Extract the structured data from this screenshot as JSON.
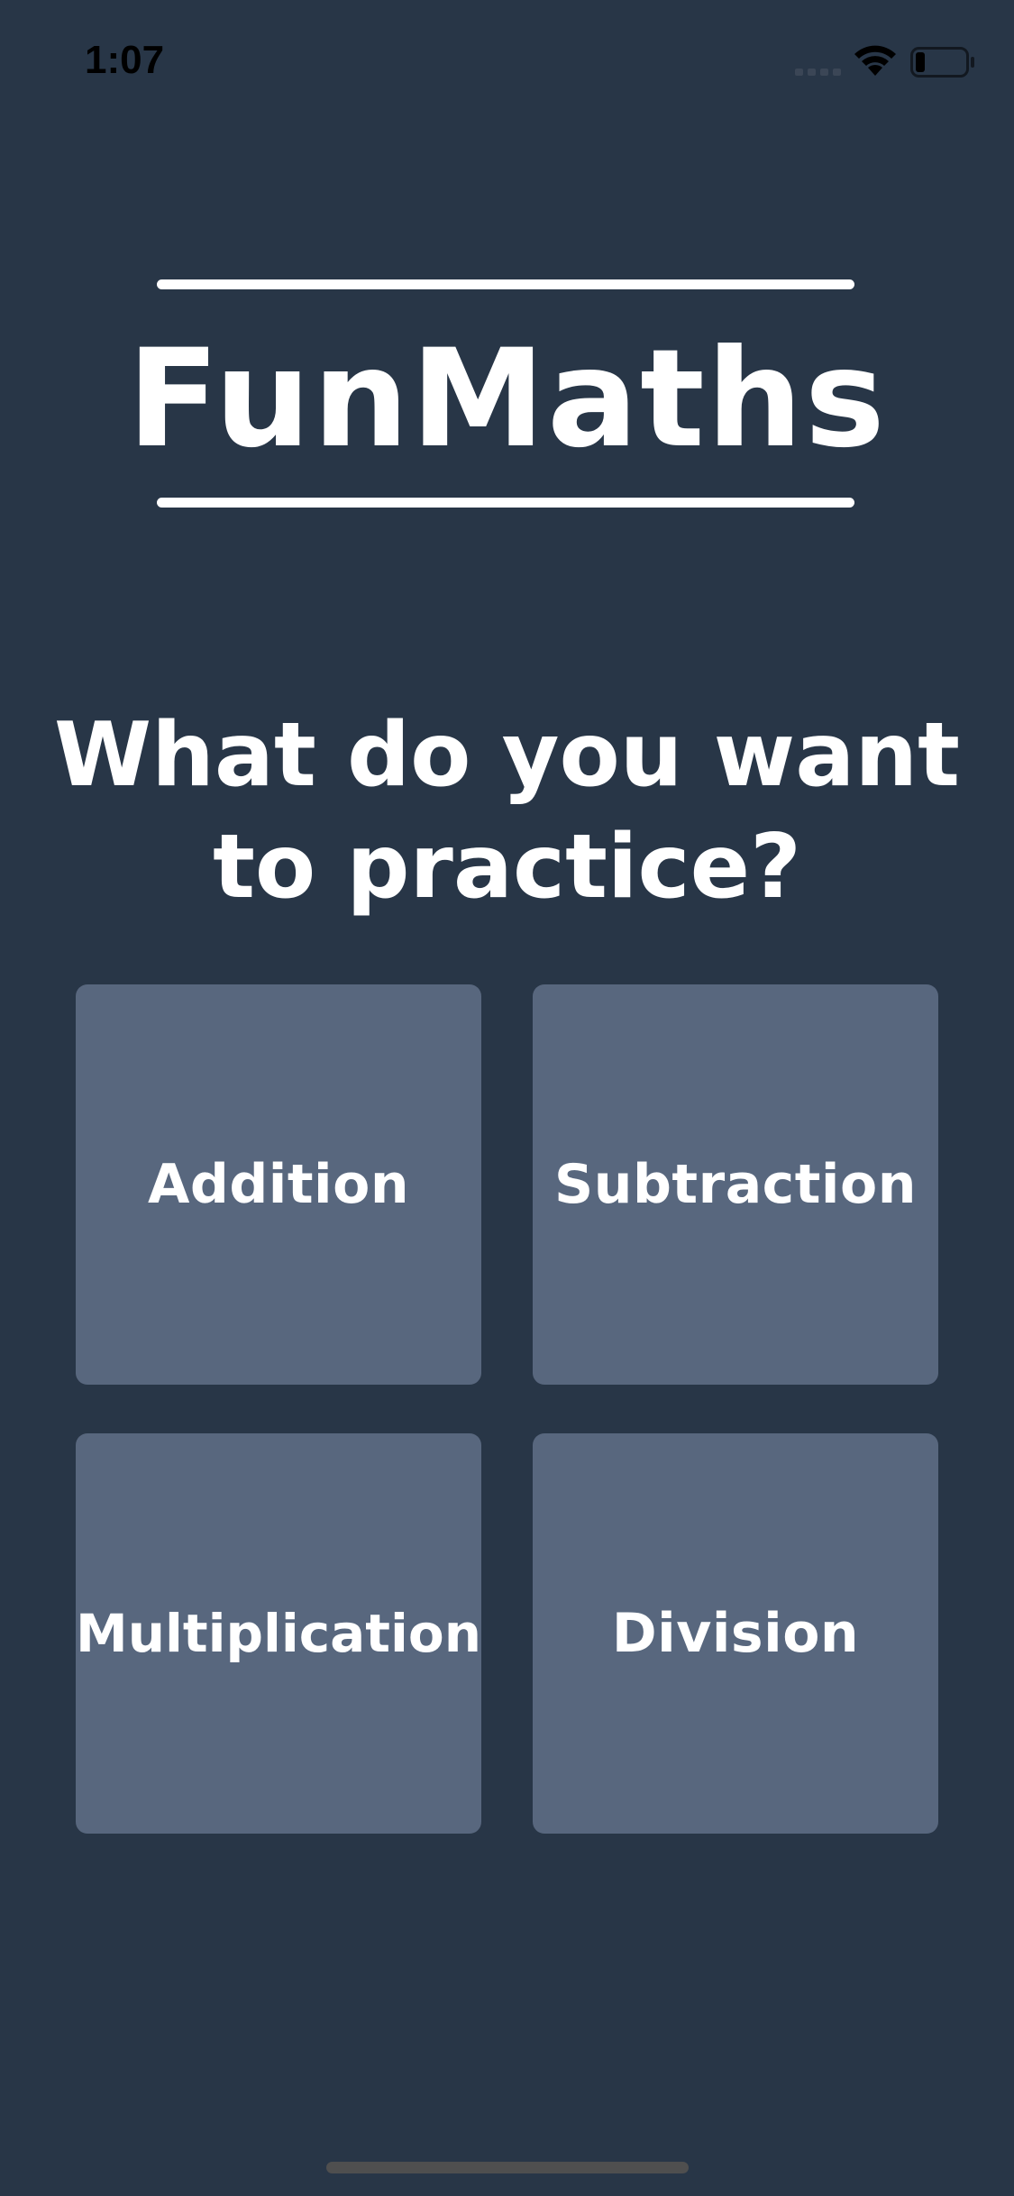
{
  "status_bar": {
    "time": "1:07",
    "icons": [
      "cellular-signal-icon",
      "wifi-icon",
      "battery-icon"
    ]
  },
  "header": {
    "title": "FunMaths"
  },
  "main": {
    "prompt": "What do you want to practice?",
    "options": [
      {
        "label": "Addition"
      },
      {
        "label": "Subtraction"
      },
      {
        "label": "Multiplication"
      },
      {
        "label": "Division"
      }
    ]
  },
  "colors": {
    "background": "#283647",
    "tile": "#58677e",
    "text": "#ffffff"
  }
}
